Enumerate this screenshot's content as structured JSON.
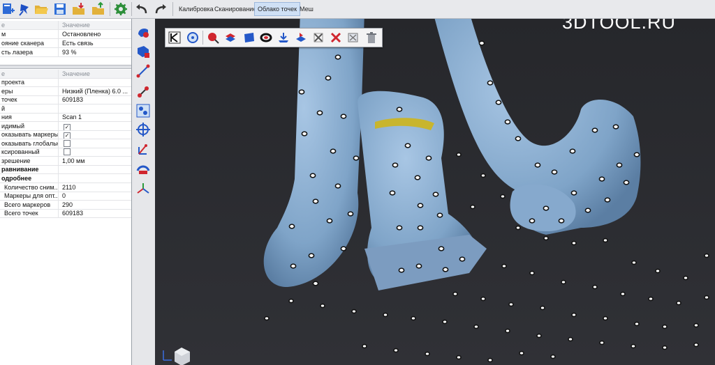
{
  "menu": {
    "tabs": [
      {
        "label": "Калибровка"
      },
      {
        "label": "Сканирование"
      },
      {
        "label": "Облако точек"
      },
      {
        "label": "Меш"
      }
    ],
    "active_tab": "Облако точек"
  },
  "toolbar_icons": [
    "new-project-icon",
    "pin-icon",
    "open-folder-icon",
    "save-icon",
    "import-icon",
    "export-icon",
    "settings-gear-icon",
    "undo-icon",
    "redo-icon"
  ],
  "scanner_panel": {
    "header": {
      "key": "е",
      "value": "Значение"
    },
    "rows": [
      {
        "key": "м",
        "value": "Остановлено"
      },
      {
        "key": "ояние сканера",
        "value": "Есть связь"
      },
      {
        "key": "сть лазера",
        "value": "93 %"
      }
    ]
  },
  "properties_panel": {
    "header": {
      "key": "е",
      "value": "Значение"
    },
    "rows": [
      {
        "key": "проекта",
        "value": ""
      },
      {
        "key": "еры",
        "value": "Низкий (Пленка)  6.0 ..."
      },
      {
        "key": "точек",
        "value": "609183"
      },
      {
        "key": "й",
        "value": ""
      },
      {
        "key": "ния",
        "value": "Scan 1"
      },
      {
        "key": "идимый",
        "value": "",
        "checked": true
      },
      {
        "key": "оказывать маркеры",
        "value": "",
        "checked": true
      },
      {
        "key": "оказывать глобальн...",
        "value": "",
        "checked": false
      },
      {
        "key": "ксированный",
        "value": "",
        "checked": false
      },
      {
        "key": "зрешение",
        "value": "1,00 мм"
      },
      {
        "key": "равнивание",
        "value": "",
        "bold": true
      },
      {
        "key": "одробнее",
        "value": "",
        "bold": true
      },
      {
        "key": "Количество сним...",
        "value": "2110"
      },
      {
        "key": "Маркеры для опт...",
        "value": "0"
      },
      {
        "key": "Всего маркеров",
        "value": "290"
      },
      {
        "key": "Всего точек",
        "value": "609183"
      }
    ]
  },
  "sidebar_icons": [
    "select-scan-icon",
    "delete-scan-icon",
    "measure-distance-icon",
    "align-points-icon",
    "transform-icon",
    "target-marker-icon",
    "coordinate-axis-icon",
    "auto-align-icon",
    "axes-icon"
  ],
  "float_toolbar_icons": [
    "exit-edit-icon",
    "rotate-view-icon",
    "select-point-icon",
    "select-layers-icon",
    "select-plane-icon",
    "lasso-ring-icon",
    "cut-below-icon",
    "invert-selection-icon",
    "deselect-icon",
    "delete-selected-icon",
    "clear-selection-icon",
    "trash-icon"
  ],
  "watermark": "3DTOOL.RU",
  "colors": {
    "accent": "#cfe0f5",
    "viewport_bg": "#2a2b2f",
    "model_blue": "#8fb3d6",
    "marker_red": "#d0262f",
    "marker_blue": "#2458c8"
  }
}
